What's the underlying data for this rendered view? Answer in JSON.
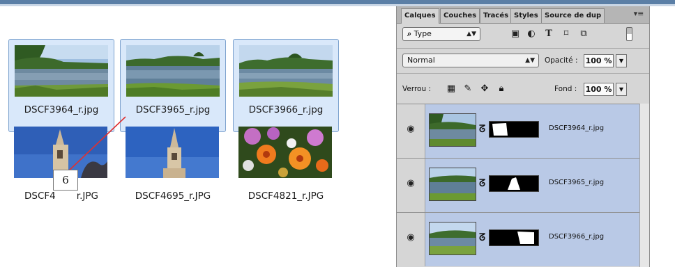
{
  "thumbnails": [
    {
      "filename": "DSCF3964_r.jpg",
      "selected": true
    },
    {
      "filename": "DSCF3965_r.jpg",
      "selected": true
    },
    {
      "filename": "DSCF3966_r.jpg",
      "selected": true
    },
    {
      "filename": "DSCF4",
      "filename_tail": "r.JPG",
      "selected": false
    },
    {
      "filename": "DSCF4695_r.JPG",
      "selected": false
    },
    {
      "filename": "DSCF4821_r.JPG",
      "selected": false
    }
  ],
  "callout": {
    "number": "6"
  },
  "layers_panel": {
    "tabs": [
      "Calques",
      "Couches",
      "Tracés",
      "Styles",
      "Source de dup"
    ],
    "active_tab": "Calques",
    "menu_icon": "panel-menu-icon",
    "filter": {
      "label": "Type",
      "icon": "search-icon"
    },
    "filter_icons": [
      "image-filter-icon",
      "adjustment-filter-icon",
      "type-filter-icon",
      "shape-filter-icon",
      "smart-object-filter-icon"
    ],
    "filter_glyphs": {
      "image": "▣",
      "adjustment": "◐",
      "type": "T",
      "shape": "⌑",
      "smart": "⧉"
    },
    "blend_mode": "Normal",
    "opacity_label": "Opacité :",
    "opacity_value": "100 %",
    "lock_label": "Verrou :",
    "lock_icons": [
      "lock-transparent-pixels-icon",
      "lock-image-pixels-icon",
      "lock-position-icon",
      "lock-all-icon"
    ],
    "fill_label": "Fond :",
    "fill_value": "100 %",
    "layers": [
      {
        "name": "DSCF3964_r.jpg",
        "visible": true
      },
      {
        "name": "DSCF3965_r.jpg",
        "visible": true
      },
      {
        "name": "DSCF3966_r.jpg",
        "visible": true
      }
    ]
  },
  "colors": {
    "selection_bg": "#d9e8fa",
    "selection_border": "#7da2ce",
    "layer_highlight": "#b9c9e6",
    "callout_line": "#e03030"
  }
}
